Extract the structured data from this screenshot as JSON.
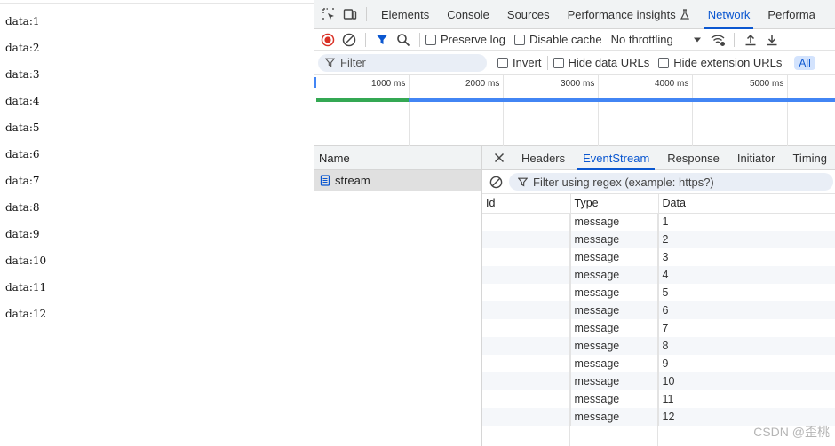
{
  "page": {
    "lines": [
      "data:1",
      "data:2",
      "data:3",
      "data:4",
      "data:5",
      "data:6",
      "data:7",
      "data:8",
      "data:9",
      "data:10",
      "data:11",
      "data:12"
    ]
  },
  "devtools": {
    "tabs": [
      "Elements",
      "Console",
      "Sources",
      "Performance insights",
      "Network",
      "Performa"
    ],
    "active_tab": "Network",
    "toolbar": {
      "preserve_log": "Preserve log",
      "disable_cache": "Disable cache",
      "throttling": "No throttling"
    },
    "filterbar": {
      "filter_placeholder": "Filter",
      "invert": "Invert",
      "hide_data_urls": "Hide data URLs",
      "hide_extension_urls": "Hide extension URLs",
      "all": "All"
    },
    "overview": {
      "ticks": [
        "1000 ms",
        "2000 ms",
        "3000 ms",
        "4000 ms",
        "5000 ms"
      ]
    },
    "requests": {
      "header": "Name",
      "items": [
        "stream"
      ]
    },
    "detail": {
      "tabs": [
        "Headers",
        "EventStream",
        "Response",
        "Initiator",
        "Timing"
      ],
      "active_tab": "EventStream",
      "filter_placeholder": "Filter using regex (example: https?)",
      "columns": [
        "Id",
        "Type",
        "Data"
      ],
      "rows": [
        [
          "",
          "message",
          "1"
        ],
        [
          "",
          "message",
          "2"
        ],
        [
          "",
          "message",
          "3"
        ],
        [
          "",
          "message",
          "4"
        ],
        [
          "",
          "message",
          "5"
        ],
        [
          "",
          "message",
          "6"
        ],
        [
          "",
          "message",
          "7"
        ],
        [
          "",
          "message",
          "8"
        ],
        [
          "",
          "message",
          "9"
        ],
        [
          "",
          "message",
          "10"
        ],
        [
          "",
          "message",
          "11"
        ],
        [
          "",
          "message",
          "12"
        ]
      ]
    }
  },
  "watermark": "CSDN @歪桃",
  "colors": {
    "accent": "#0b57d0",
    "record": "#d93025",
    "green": "#34a853",
    "blue": "#4285f4"
  }
}
